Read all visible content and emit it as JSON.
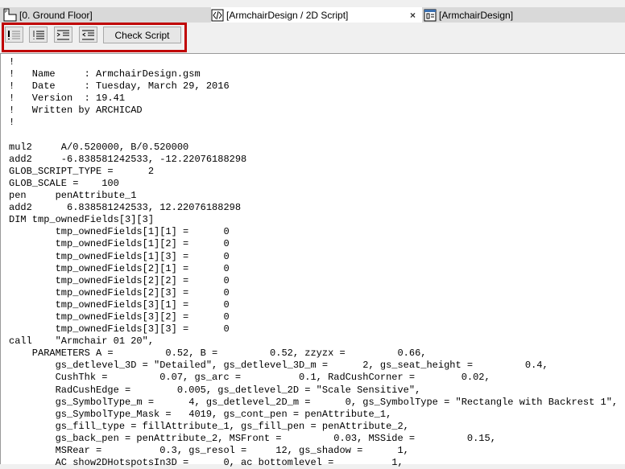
{
  "tabs": [
    {
      "label": "[0. Ground Floor]",
      "icon": "floor-plan-icon"
    },
    {
      "label": "[ArmchairDesign / 2D Script]",
      "icon": "script-icon",
      "active": true,
      "close": "×"
    },
    {
      "label": "[ArmchairDesign]",
      "icon": "object-settings-icon"
    }
  ],
  "toolbar": {
    "check_script": "Check Script",
    "buttons": [
      "comment-icon",
      "uncomment-icon",
      "indent-icon",
      "outdent-icon"
    ]
  },
  "script_lines": [
    "!",
    "!   Name     : ArmchairDesign.gsm",
    "!   Date     : Tuesday, March 29, 2016",
    "!   Version  : 19.41",
    "!   Written by ARCHICAD",
    "!",
    "",
    "mul2     A/0.520000, B/0.520000",
    "add2     -6.838581242533, -12.22076188298",
    "GLOB_SCRIPT_TYPE =      2",
    "GLOB_SCALE =    100",
    "pen     penAttribute_1",
    "add2      6.838581242533, 12.22076188298",
    "DIM tmp_ownedFields[3][3]",
    "        tmp_ownedFields[1][1] =      0",
    "        tmp_ownedFields[1][2] =      0",
    "        tmp_ownedFields[1][3] =      0",
    "        tmp_ownedFields[2][1] =      0",
    "        tmp_ownedFields[2][2] =      0",
    "        tmp_ownedFields[2][3] =      0",
    "        tmp_ownedFields[3][1] =      0",
    "        tmp_ownedFields[3][2] =      0",
    "        tmp_ownedFields[3][3] =      0",
    "call    \"Armchair 01 20\",",
    "    PARAMETERS A =         0.52, B =         0.52, zzyzx =         0.66,",
    "        gs_detlevel_3D = \"Detailed\", gs_detlevel_3D_m =      2, gs_seat_height =         0.4,",
    "        CushThk =         0.07, gs_arc =          0.1, RadCushCorner =        0.02,",
    "        RadCushEdge =        0.005, gs_detlevel_2D = \"Scale Sensitive\",",
    "        gs_SymbolType_m =      4, gs_detlevel_2D_m =      0, gs_SymbolType = \"Rectangle with Backrest 1\",",
    "        gs_SymbolType_Mask =   4019, gs_cont_pen = penAttribute_1,",
    "        gs_fill_type = fillAttribute_1, gs_fill_pen = penAttribute_2,",
    "        gs_back_pen = penAttribute_2, MSFront =         0.03, MSSide =         0.15,",
    "        MSRear =          0.3, gs_resol =     12, gs_shadow =      1,",
    "        AC show2DHotspotsIn3D =      0, ac bottomlevel =          1,"
  ]
}
